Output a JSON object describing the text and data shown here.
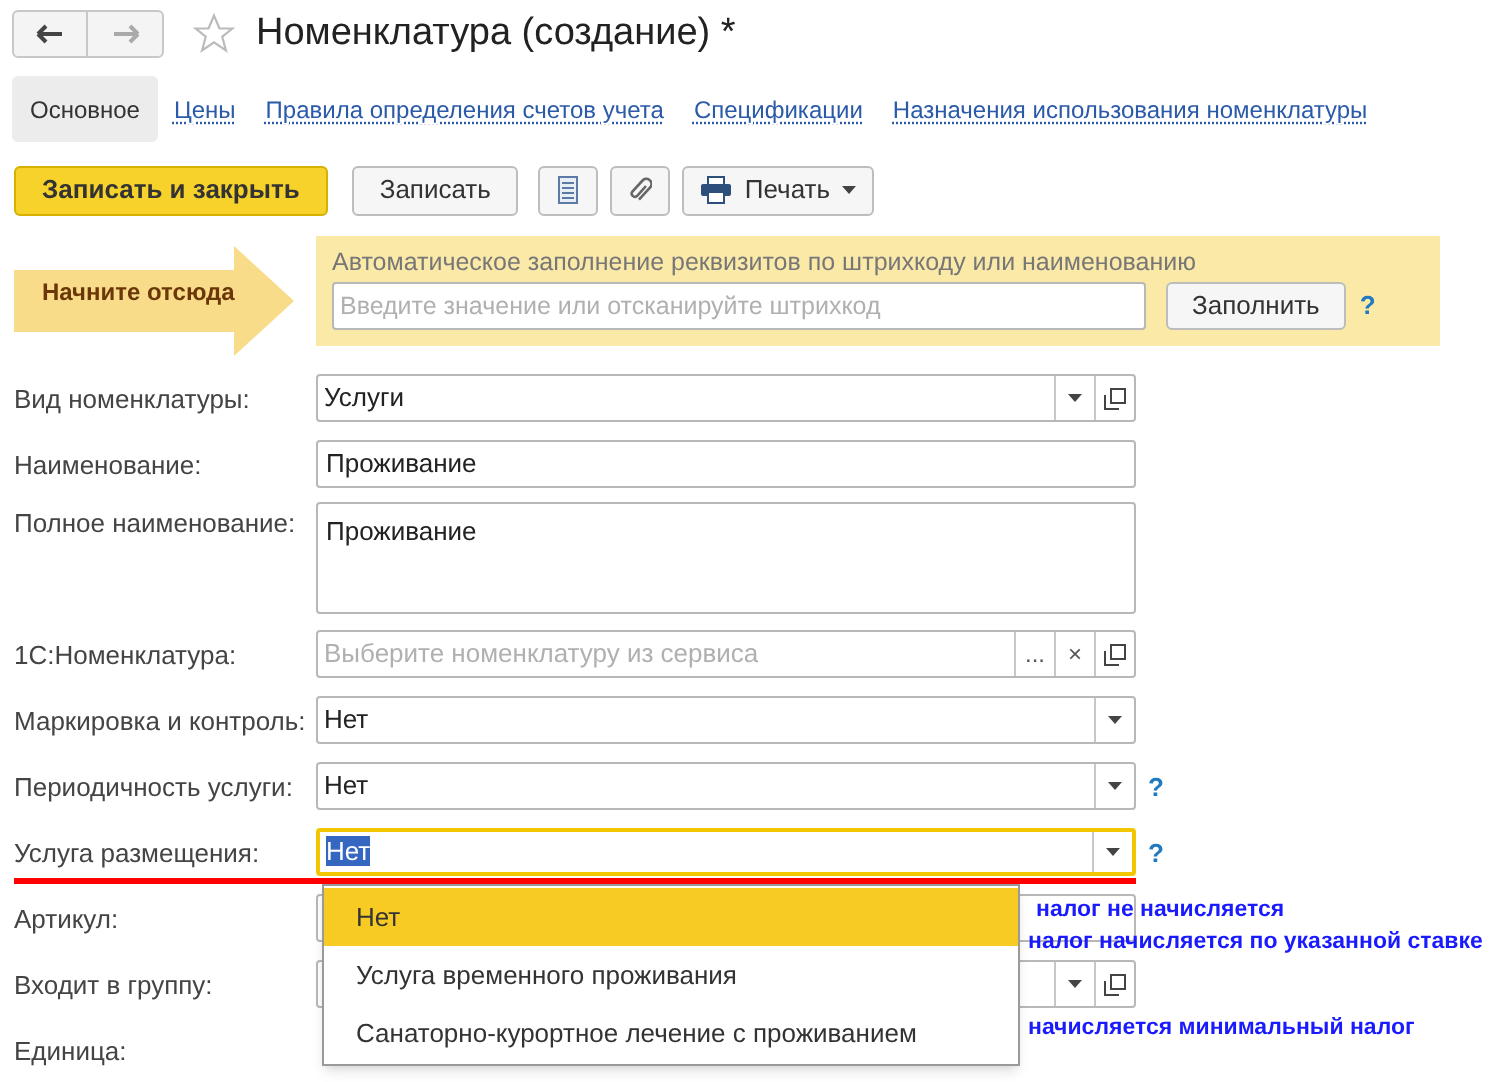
{
  "window": {
    "title": "Номенклатура (создание) *"
  },
  "tabs": [
    {
      "label": "Основное",
      "selected": true
    },
    {
      "label": "Цены",
      "selected": false
    },
    {
      "label": "Правила определения счетов учета",
      "selected": false
    },
    {
      "label": "Спецификации",
      "selected": false
    },
    {
      "label": "Назначения использования номенклатуры",
      "selected": false
    }
  ],
  "toolbar": [
    {
      "kind": "primary",
      "label": "Записать и закрыть"
    },
    {
      "kind": "plain",
      "label": "Записать"
    },
    {
      "kind": "list_icon"
    },
    {
      "kind": "clip_icon"
    },
    {
      "kind": "print_menu",
      "label": "Печать"
    }
  ],
  "start_banner": {
    "label": "Начните отсюда"
  },
  "autofill": {
    "caption": "Автоматическое заполнение реквизитов по штрихкоду или наименованию",
    "placeholder": "Введите значение или отсканируйте штрихкод",
    "button": "Заполнить",
    "help": "?"
  },
  "fields": [
    {
      "label": "Вид номенклатуры:",
      "kind": "combo_open",
      "value": "Услуги",
      "focused": false
    },
    {
      "label": "Наименование:",
      "kind": "text",
      "value": "Проживание",
      "focused": false
    },
    {
      "label": "Полное наименование:",
      "kind": "textarea",
      "value": "Проживание",
      "focused": false
    },
    {
      "label": "1С:Номенклатура:",
      "kind": "picker",
      "placeholder": "Выберите номенклатуру из сервиса",
      "more": "...",
      "clear": "×",
      "focused": false
    },
    {
      "label": "Маркировка и контроль:",
      "kind": "combo",
      "value": "Нет",
      "focused": false
    },
    {
      "label": "Периодичность услуги:",
      "kind": "combo",
      "value": "Нет",
      "help": "?",
      "focused": false
    },
    {
      "label": "Услуга размещения:",
      "kind": "combo",
      "value": "Нет",
      "help": "?",
      "focused": true
    },
    {
      "label": "Артикул:",
      "kind": "text",
      "focused": false
    },
    {
      "label": "Входит в группу:",
      "kind": "combo_open",
      "focused": false
    },
    {
      "label": "Единица:",
      "kind": "label_only"
    }
  ],
  "dropdown": {
    "options": [
      {
        "label": "Нет",
        "selected": true
      },
      {
        "label": "Услуга временного проживания",
        "selected": false
      },
      {
        "label": "Санаторно-курортное лечение с проживанием",
        "selected": false
      }
    ]
  },
  "annotations": [
    "налог не начисляется",
    "налог начисляется по указанной ставке",
    "начисляется минимальный налог"
  ]
}
